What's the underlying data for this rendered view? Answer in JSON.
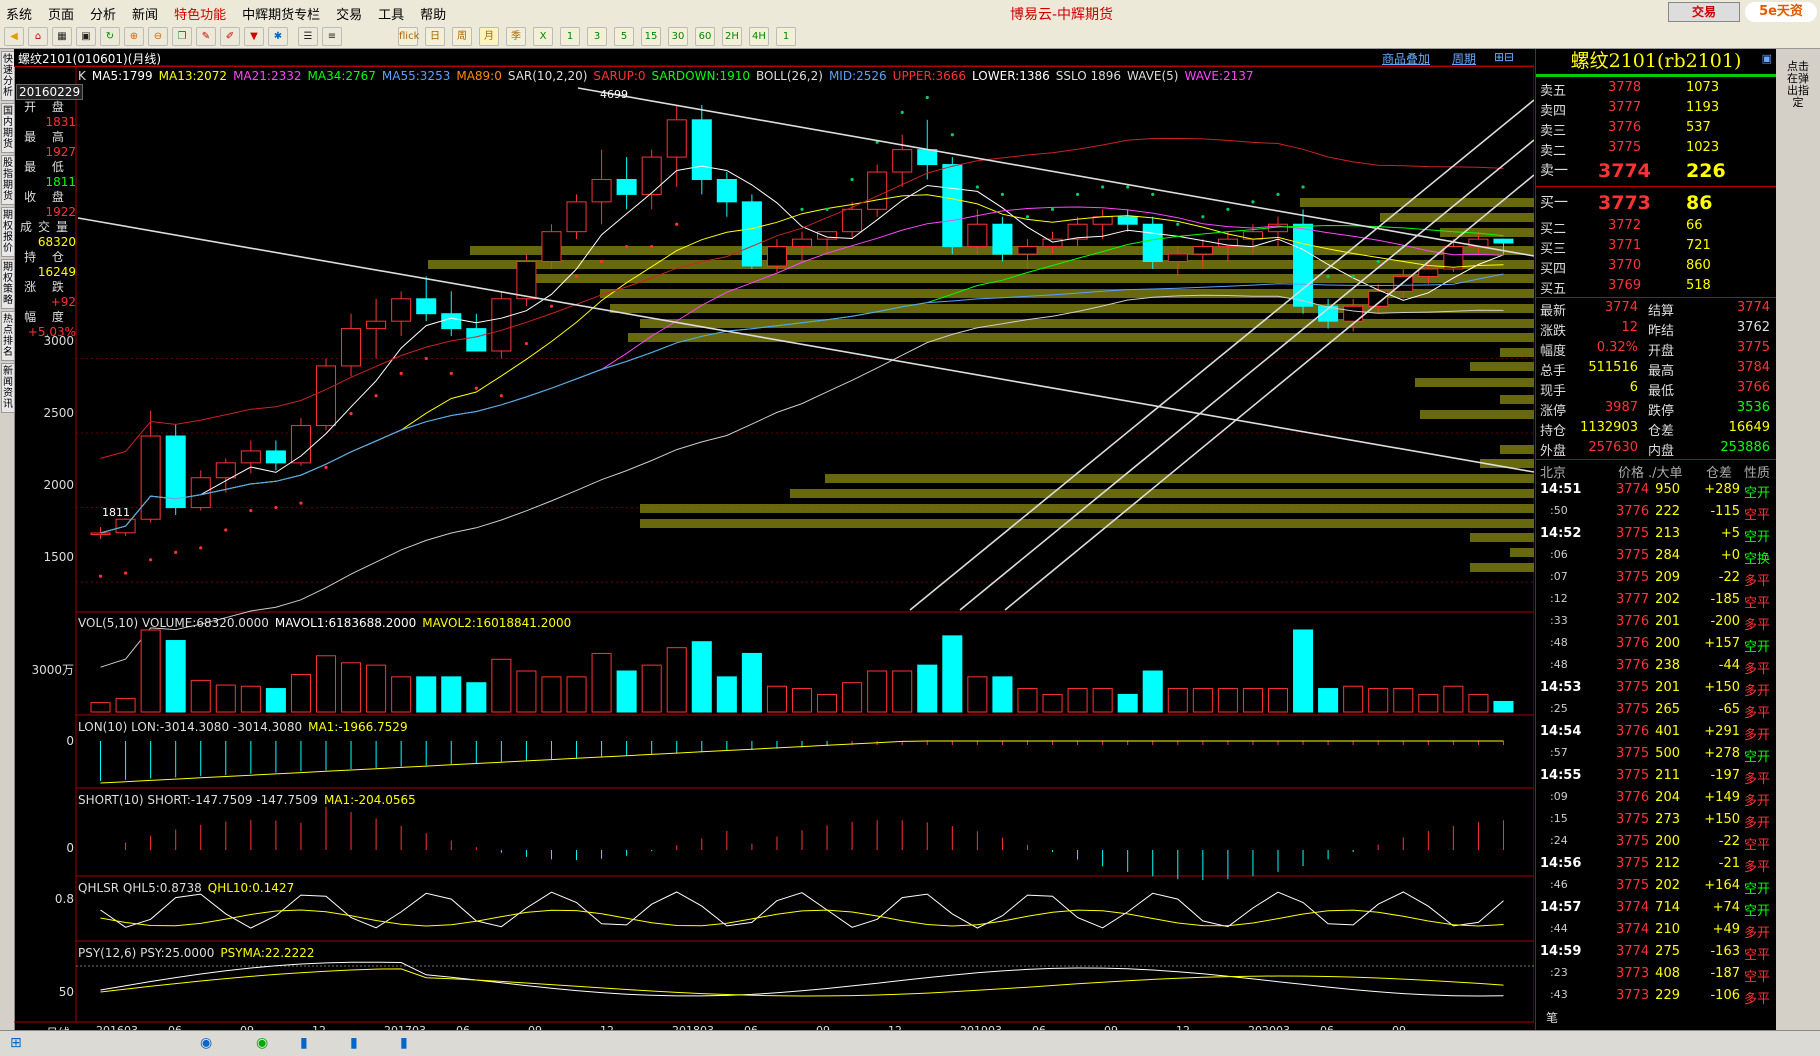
{
  "menu": [
    "系统",
    "页面",
    "分析",
    "新闻",
    "特色功能",
    "中辉期货专栏",
    "交易",
    "工具",
    "帮助"
  ],
  "window_title": "博易云-中辉期货",
  "trade_button": "交易",
  "logo": "5e天资",
  "toolbar_labels": [
    "flick",
    "日",
    "周",
    "月",
    "季",
    "X",
    "1",
    "3",
    "5",
    "15",
    "30",
    "60",
    "2H",
    "4H",
    "1"
  ],
  "sidebar_tabs": [
    "快速分析",
    "国内期货",
    "股指期货",
    "期权报价",
    "期权策略",
    "热点排名",
    "新闻资讯"
  ],
  "chart_header": {
    "title": "螺纹2101(010601)(月线)",
    "link1": "商品叠加",
    "link2": "周期"
  },
  "main_indicators": [
    {
      "text": "K",
      "color": "#dddddd"
    },
    {
      "text": "MA5:1799",
      "color": "#ffffff"
    },
    {
      "text": "MA13:2072",
      "color": "#ffff00"
    },
    {
      "text": "MA21:2332",
      "color": "#ff44ff"
    },
    {
      "text": "MA34:2767",
      "color": "#00ff00"
    },
    {
      "text": "MA55:3253",
      "color": "#5aa0ff"
    },
    {
      "text": "MA89:0",
      "color": "#ff8800"
    },
    {
      "text": "SAR(10,2,20)",
      "color": "#dddddd"
    },
    {
      "text": "SARUP:0",
      "color": "#ff3333"
    },
    {
      "text": "SARDOWN:1910",
      "color": "#00ff00"
    },
    {
      "text": "BOLL(26,2)",
      "color": "#dddddd"
    },
    {
      "text": "MID:2526",
      "color": "#5aa0ff"
    },
    {
      "text": "UPPER:3666",
      "color": "#ff3333"
    },
    {
      "text": "LOWER:1386",
      "color": "#ffffff"
    },
    {
      "text": "SSLO 1896",
      "color": "#dddddd"
    },
    {
      "text": "WAVE(5)",
      "color": "#dddddd"
    },
    {
      "text": "WAVE:2137",
      "color": "#ff44ff"
    }
  ],
  "info_date": "20160229",
  "info": [
    {
      "label": "开 盘",
      "value": "1831",
      "color": "#ff3333"
    },
    {
      "label": "最 高",
      "value": "1927",
      "color": "#ff3333"
    },
    {
      "label": "最 低",
      "value": "1811",
      "color": "#00ff00"
    },
    {
      "label": "收 盘",
      "value": "1922",
      "color": "#ff3333"
    },
    {
      "label": "成交量",
      "value": "68320",
      "color": "#ffff00"
    },
    {
      "label": "持 仓",
      "value": "16249",
      "color": "#ffff00"
    },
    {
      "label": "涨 跌",
      "value": "+92",
      "color": "#ff3333"
    },
    {
      "label": "幅 度",
      "value": "+5.03%",
      "color": "#ff3333"
    }
  ],
  "price_axis": [
    "3000",
    "2500",
    "2000",
    "1500"
  ],
  "high_label": "4699",
  "low_label": "1811",
  "vol_indicator": [
    {
      "text": "VOL(5,10) VOLUME:68320.0000",
      "color": "#dddddd"
    },
    {
      "text": "MAVOL1:6183688.2000",
      "color": "#ffffff"
    },
    {
      "text": "MAVOL2:16018841.2000",
      "color": "#ffff00"
    }
  ],
  "vol_axis": "3000万",
  "lon_indicator": [
    {
      "text": "LON(10) LON:-3014.3080 -3014.3080",
      "color": "#dddddd"
    },
    {
      "text": "MA1:-1966.7529",
      "color": "#ffff00"
    }
  ],
  "lon_axis": "0",
  "short_indicator": [
    {
      "text": "SHORT(10) SHORT:-147.7509 -147.7509",
      "color": "#dddddd"
    },
    {
      "text": "MA1:-204.0565",
      "color": "#ffff00"
    }
  ],
  "short_axis": "0",
  "qhlsr_indicator": [
    {
      "text": "QHLSR QHL5:0.8738",
      "color": "#dddddd"
    },
    {
      "text": "QHL10:0.1427",
      "color": "#ffff00"
    }
  ],
  "qhlsr_axis": "0.8",
  "psy_indicator": [
    {
      "text": "PSY(12,6) PSY:25.0000",
      "color": "#dddddd"
    },
    {
      "text": "PSYMA:22.2222",
      "color": "#ffff00"
    }
  ],
  "psy_axis": "50",
  "period_label": "月线",
  "x_axis": [
    "201603",
    "06",
    "09",
    "12",
    "201703",
    "06",
    "09",
    "12",
    "201803",
    "06",
    "09",
    "12",
    "201903",
    "06",
    "09",
    "12",
    "202003",
    "06",
    "09"
  ],
  "quote_title": "螺纹2101(rb2101)",
  "asks": [
    {
      "label": "卖五",
      "price": "3778",
      "vol": "1073"
    },
    {
      "label": "卖四",
      "price": "3777",
      "vol": "1193"
    },
    {
      "label": "卖三",
      "price": "3776",
      "vol": "537"
    },
    {
      "label": "卖二",
      "price": "3775",
      "vol": "1023"
    },
    {
      "label": "卖一",
      "price": "3774",
      "vol": "226"
    }
  ],
  "bids": [
    {
      "label": "买一",
      "price": "3773",
      "vol": "86"
    },
    {
      "label": "买二",
      "price": "3772",
      "vol": "66"
    },
    {
      "label": "买三",
      "price": "3771",
      "vol": "721"
    },
    {
      "label": "买四",
      "price": "3770",
      "vol": "860"
    },
    {
      "label": "买五",
      "price": "3769",
      "vol": "518"
    }
  ],
  "stats": [
    {
      "l1": "最新",
      "v1": "3774",
      "c1": "#ff3333",
      "l2": "结算",
      "v2": "3774",
      "c2": "#ff3333"
    },
    {
      "l1": "涨跌",
      "v1": "12",
      "c1": "#ff3333",
      "l2": "昨结",
      "v2": "3762",
      "c2": "#dddddd"
    },
    {
      "l1": "幅度",
      "v1": "0.32%",
      "c1": "#ff3333",
      "l2": "开盘",
      "v2": "3775",
      "c2": "#ff3333"
    },
    {
      "l1": "总手",
      "v1": "511516",
      "c1": "#ffff00",
      "l2": "最高",
      "v2": "3784",
      "c2": "#ff3333"
    },
    {
      "l1": "现手",
      "v1": "6",
      "c1": "#ffff00",
      "l2": "最低",
      "v2": "3766",
      "c2": "#ff3333"
    },
    {
      "l1": "涨停",
      "v1": "3987",
      "c1": "#ff3333",
      "l2": "跌停",
      "v2": "3536",
      "c2": "#00ff00"
    },
    {
      "l1": "持仓",
      "v1": "1132903",
      "c1": "#ffff00",
      "l2": "仓差",
      "v2": "16649",
      "c2": "#ffff00"
    },
    {
      "l1": "外盘",
      "v1": "257630",
      "c1": "#ff3333",
      "l2": "内盘",
      "v2": "253886",
      "c2": "#00ff00"
    }
  ],
  "tick_header": [
    "北京",
    "价格",
    "./大单",
    "仓差",
    "性质"
  ],
  "ticks": [
    {
      "t": "14:51",
      "big": true,
      "p": "3774",
      "pc": "#ff3333",
      "v": "950",
      "d": "+289",
      "k": "空开",
      "kc": "#00ff00"
    },
    {
      "t": ":50",
      "big": false,
      "p": "3776",
      "pc": "#ff3333",
      "v": "222",
      "d": "-115",
      "k": "空平",
      "kc": "#ff3333"
    },
    {
      "t": "14:52",
      "big": true,
      "p": "3775",
      "pc": "#ff3333",
      "v": "213",
      "d": "+5",
      "k": "空开",
      "kc": "#00ff00"
    },
    {
      "t": ":06",
      "big": false,
      "p": "3775",
      "pc": "#ff3333",
      "v": "284",
      "d": "+0",
      "k": "空换",
      "kc": "#00ff00"
    },
    {
      "t": ":07",
      "big": false,
      "p": "3775",
      "pc": "#ff3333",
      "v": "209",
      "d": "-22",
      "k": "多平",
      "kc": "#ff3333"
    },
    {
      "t": ":12",
      "big": false,
      "p": "3777",
      "pc": "#ff3333",
      "v": "202",
      "d": "-185",
      "k": "空平",
      "kc": "#ff3333"
    },
    {
      "t": ":33",
      "big": false,
      "p": "3776",
      "pc": "#ff3333",
      "v": "201",
      "d": "-200",
      "k": "多平",
      "kc": "#ff3333"
    },
    {
      "t": ":48",
      "big": false,
      "p": "3776",
      "pc": "#ff3333",
      "v": "200",
      "d": "+157",
      "k": "空开",
      "kc": "#00ff00"
    },
    {
      "t": ":48",
      "big": false,
      "p": "3776",
      "pc": "#ff3333",
      "v": "238",
      "d": "-44",
      "k": "多平",
      "kc": "#ff3333"
    },
    {
      "t": "14:53",
      "big": true,
      "p": "3775",
      "pc": "#ff3333",
      "v": "201",
      "d": "+150",
      "k": "多开",
      "kc": "#ff3333"
    },
    {
      "t": ":25",
      "big": false,
      "p": "3775",
      "pc": "#ff3333",
      "v": "265",
      "d": "-65",
      "k": "多平",
      "kc": "#ff3333"
    },
    {
      "t": "14:54",
      "big": true,
      "p": "3776",
      "pc": "#ff3333",
      "v": "401",
      "d": "+291",
      "k": "多开",
      "kc": "#ff3333"
    },
    {
      "t": ":57",
      "big": false,
      "p": "3775",
      "pc": "#ff3333",
      "v": "500",
      "d": "+278",
      "k": "空开",
      "kc": "#00ff00"
    },
    {
      "t": "14:55",
      "big": true,
      "p": "3775",
      "pc": "#ff3333",
      "v": "211",
      "d": "-197",
      "k": "多平",
      "kc": "#ff3333"
    },
    {
      "t": ":09",
      "big": false,
      "p": "3776",
      "pc": "#ff3333",
      "v": "204",
      "d": "+149",
      "k": "多开",
      "kc": "#ff3333"
    },
    {
      "t": ":15",
      "big": false,
      "p": "3775",
      "pc": "#ff3333",
      "v": "273",
      "d": "+150",
      "k": "多开",
      "kc": "#ff3333"
    },
    {
      "t": ":24",
      "big": false,
      "p": "3775",
      "pc": "#ff3333",
      "v": "200",
      "d": "-22",
      "k": "空平",
      "kc": "#ff3333"
    },
    {
      "t": "14:56",
      "big": true,
      "p": "3775",
      "pc": "#ff3333",
      "v": "212",
      "d": "-21",
      "k": "多平",
      "kc": "#ff3333"
    },
    {
      "t": ":46",
      "big": false,
      "p": "3775",
      "pc": "#ff3333",
      "v": "202",
      "d": "+164",
      "k": "空开",
      "kc": "#00ff00"
    },
    {
      "t": "14:57",
      "big": true,
      "p": "3774",
      "pc": "#ff3333",
      "v": "714",
      "d": "+74",
      "k": "空开",
      "kc": "#00ff00"
    },
    {
      "t": ":44",
      "big": false,
      "p": "3774",
      "pc": "#ff3333",
      "v": "210",
      "d": "+49",
      "k": "多开",
      "kc": "#ff3333"
    },
    {
      "t": "14:59",
      "big": true,
      "p": "3774",
      "pc": "#ff3333",
      "v": "275",
      "d": "-163",
      "k": "空平",
      "kc": "#ff3333"
    },
    {
      "t": ":23",
      "big": false,
      "p": "3773",
      "pc": "#ff3333",
      "v": "408",
      "d": "-187",
      "k": "空平",
      "kc": "#ff3333"
    },
    {
      "t": ":43",
      "big": false,
      "p": "3773",
      "pc": "#ff3333",
      "v": "229",
      "d": "-106",
      "k": "多平",
      "kc": "#ff3333"
    }
  ],
  "tick_footer": "笔",
  "right_side_text": "点击在弹出指定",
  "chart_data": {
    "type": "candlestick",
    "title": "螺纹2101(010601)(月线)",
    "period": "monthly",
    "x": [
      "201601",
      "201602",
      "201603",
      "201604",
      "201605",
      "201606",
      "201607",
      "201608",
      "201609",
      "201610",
      "201611",
      "201612",
      "201701",
      "201702",
      "201703",
      "201704",
      "201705",
      "201706",
      "201707",
      "201708",
      "201709",
      "201710",
      "201711",
      "201712",
      "201801",
      "201802",
      "201803",
      "201804",
      "201805",
      "201806",
      "201807",
      "201808",
      "201809",
      "201810",
      "201811",
      "201812",
      "201901",
      "201902",
      "201903",
      "201904",
      "201905",
      "201906",
      "201907",
      "201908",
      "201909",
      "201910",
      "201911",
      "201912",
      "202001",
      "202002",
      "202003",
      "202004",
      "202005",
      "202006",
      "202007",
      "202008",
      "202009"
    ],
    "ohlc": [
      [
        1820,
        1870,
        1790,
        1830
      ],
      [
        1831,
        1927,
        1811,
        1922
      ],
      [
        1922,
        2650,
        1900,
        2480
      ],
      [
        2480,
        2560,
        1950,
        2000
      ],
      [
        2000,
        2250,
        1980,
        2200
      ],
      [
        2200,
        2330,
        2100,
        2300
      ],
      [
        2300,
        2450,
        2230,
        2380
      ],
      [
        2380,
        2450,
        2250,
        2300
      ],
      [
        2300,
        2600,
        2280,
        2550
      ],
      [
        2550,
        3000,
        2520,
        2950
      ],
      [
        2950,
        3300,
        2880,
        3200
      ],
      [
        3200,
        3400,
        3000,
        3250
      ],
      [
        3250,
        3450,
        3150,
        3400
      ],
      [
        3400,
        3550,
        3250,
        3300
      ],
      [
        3300,
        3450,
        3150,
        3200
      ],
      [
        3200,
        3300,
        3050,
        3050
      ],
      [
        3050,
        3450,
        3000,
        3400
      ],
      [
        3400,
        3700,
        3350,
        3650
      ],
      [
        3650,
        3900,
        3600,
        3850
      ],
      [
        3850,
        4100,
        3800,
        4050
      ],
      [
        4050,
        4400,
        3900,
        4200
      ],
      [
        4200,
        4350,
        4000,
        4100
      ],
      [
        4100,
        4400,
        4000,
        4350
      ],
      [
        4350,
        4699,
        4150,
        4600
      ],
      [
        4600,
        4700,
        4100,
        4200
      ],
      [
        4200,
        4250,
        3950,
        4050
      ],
      [
        4050,
        4100,
        3600,
        3620
      ],
      [
        3620,
        3800,
        3580,
        3750
      ],
      [
        3750,
        3850,
        3650,
        3800
      ],
      [
        3800,
        3850,
        3700,
        3850
      ],
      [
        3850,
        4050,
        3800,
        4000
      ],
      [
        4000,
        4300,
        3950,
        4250
      ],
      [
        4250,
        4500,
        4150,
        4400
      ],
      [
        4400,
        4600,
        4200,
        4300
      ],
      [
        4300,
        4350,
        3700,
        3750
      ],
      [
        3750,
        4000,
        3700,
        3900
      ],
      [
        3900,
        3950,
        3650,
        3700
      ],
      [
        3700,
        3800,
        3600,
        3750
      ],
      [
        3750,
        3850,
        3700,
        3800
      ],
      [
        3800,
        3950,
        3750,
        3900
      ],
      [
        3900,
        4000,
        3800,
        3950
      ],
      [
        3950,
        4000,
        3850,
        3900
      ],
      [
        3900,
        3950,
        3600,
        3650
      ],
      [
        3650,
        3750,
        3550,
        3700
      ],
      [
        3700,
        3800,
        3600,
        3750
      ],
      [
        3750,
        3850,
        3650,
        3800
      ],
      [
        3800,
        3900,
        3700,
        3850
      ],
      [
        3850,
        3950,
        3750,
        3900
      ],
      [
        3900,
        4000,
        3300,
        3350
      ],
      [
        3350,
        3400,
        3200,
        3250
      ],
      [
        3250,
        3400,
        3180,
        3350
      ],
      [
        3350,
        3500,
        3300,
        3450
      ],
      [
        3450,
        3600,
        3400,
        3550
      ],
      [
        3550,
        3650,
        3500,
        3600
      ],
      [
        3600,
        3800,
        3580,
        3750
      ],
      [
        3750,
        3850,
        3700,
        3800
      ],
      [
        3800,
        3790,
        3700,
        3774
      ]
    ],
    "ylim": [
      1300,
      4800
    ]
  }
}
